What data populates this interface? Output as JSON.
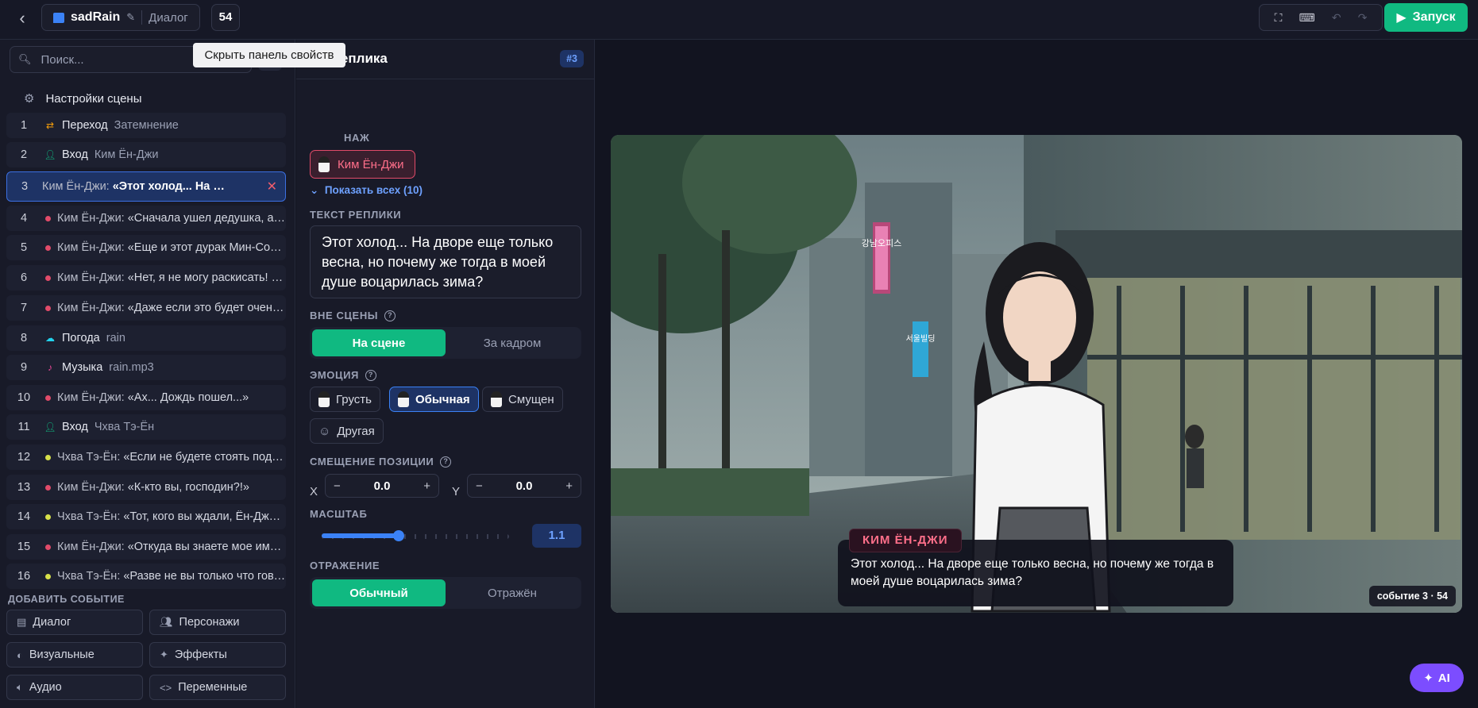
{
  "topbar": {
    "project_name": "sadRain",
    "project_type": "Диалог",
    "event_count": "54",
    "run_label": "Запуск",
    "tool_icons": [
      "fullscreen-icon",
      "keyboard-icon",
      "undo-icon",
      "redo-icon"
    ]
  },
  "sidebar": {
    "search_placeholder": "Поиск...",
    "tooltip": "Скрыть панель свойств",
    "scene_settings": "Настройки сцены",
    "events": [
      {
        "num": "1",
        "kind": "Переход",
        "detail": "Затемнение",
        "icon": "transition-icon"
      },
      {
        "num": "2",
        "kind": "Вход",
        "detail": "Ким Ён-Джи",
        "icon": "enter-icon"
      },
      {
        "num": "3",
        "speaker": "Ким Ён-Джи:",
        "line": "«Этот холод... На дворе еще только весна, но почему же тогда в моей душе воцарилась зима?»",
        "selected": true
      },
      {
        "num": "4",
        "speaker": "Ким Ён-Джи:",
        "line": "«Сначала ушел дедушка, а потом...»"
      },
      {
        "num": "5",
        "speaker": "Ким Ён-Джи:",
        "line": "«Еще и этот дурак Мин-Сок...»"
      },
      {
        "num": "6",
        "speaker": "Ким Ён-Джи:",
        "line": "«Нет, я не могу раскисать! ...»"
      },
      {
        "num": "7",
        "speaker": "Ким Ён-Джи:",
        "line": "«Даже если это будет очень...»"
      },
      {
        "num": "8",
        "kind": "Погода",
        "detail": "rain",
        "icon": "cloud-icon"
      },
      {
        "num": "9",
        "kind": "Музыка",
        "detail": "rain.mp3",
        "icon": "music-icon"
      },
      {
        "num": "10",
        "speaker": "Ким Ён-Джи:",
        "line": "«Ах... Дождь пошел...»"
      },
      {
        "num": "11",
        "kind": "Вход",
        "detail": "Чхва Тэ-Ён",
        "icon": "enter-icon"
      },
      {
        "num": "12",
        "speaker": "Чхва Тэ-Ён:",
        "line": "«Если не будете стоять под дождем...»"
      },
      {
        "num": "13",
        "speaker": "Ким Ён-Джи:",
        "line": "«К-кто вы, господин?!»"
      },
      {
        "num": "14",
        "speaker": "Чхва Тэ-Ён:",
        "line": "«Тот, кого вы ждали, Ён-Джи...»"
      },
      {
        "num": "15",
        "speaker": "Ким Ён-Джи:",
        "line": "«Откуда вы знаете мое имя...»"
      },
      {
        "num": "16",
        "speaker": "Чхва Тэ-Ён:",
        "line": "«Разве не вы только что говорили...»"
      }
    ],
    "add_title": "ДОБАВИТЬ СОБЫТИЕ",
    "add_buttons": [
      "Диалог",
      "Персонажи",
      "Визуальные",
      "Эффекты",
      "Аудио",
      "Переменные"
    ]
  },
  "props": {
    "title": "Реплика",
    "badge": "#3",
    "character_label_partial": "НАЖ",
    "character": "Ким Ён-Джи",
    "show_all": "Показать всех (10)",
    "text_label": "ТЕКСТ РЕПЛИКИ",
    "text_value": "Этот холод... На дворе еще только весна, но почему же тогда в моей душе воцарилась зима?",
    "offscene_label": "ВНЕ СЦЕНЫ",
    "offscene_options": [
      "На сцене",
      "За кадром"
    ],
    "emotion_label": "ЭМОЦИЯ",
    "emotions": [
      "Грусть",
      "Обычная",
      "Смущен",
      "Другая"
    ],
    "offset_label": "СМЕЩЕНИЕ ПОЗИЦИИ",
    "x_label": "X",
    "y_label": "Y",
    "x_value": "0.0",
    "y_value": "0.0",
    "scale_label": "МАСШТАБ",
    "scale_value": "1.1",
    "reflect_label": "ОТРАЖЕНИЕ",
    "reflect_options": [
      "Обычный",
      "Отражён"
    ]
  },
  "preview": {
    "speaker": "КИМ ЁН-ДЖИ",
    "text": "Этот холод... На дворе еще только весна, но почему же тогда в моей душе воцарилась зима?",
    "counter": "событие 3 · 54",
    "signs": [
      "강남오피스",
      "서울빌딩"
    ]
  },
  "ai_button": "AI",
  "colors": {
    "accent_green": "#10b981",
    "accent_blue": "#3b82f6",
    "speaker_pink": "#ff6f8a",
    "ai_purple": "#7c4dff"
  }
}
